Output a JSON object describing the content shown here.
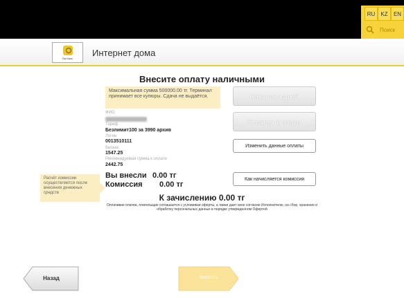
{
  "languages": [
    "RU",
    "KZ",
    "EN"
  ],
  "search": {
    "placeholder": "Поиск",
    "icon": "search-icon"
  },
  "header": {
    "title": "Интернет дома",
    "logo_caption": "Ва-банк"
  },
  "main": {
    "heading": "Внесите оплату наличными",
    "notice": "Максимальная сумма 500000.00 тг. Терминал принимает все купюры. Сдача не выдаётся.",
    "fields": {
      "fio_label": "ФИО",
      "tariff_label": "Тариф",
      "tariff_value": "Безлимит100 за 3990 архив",
      "login_label": "Логин",
      "login_value": "0013510111",
      "balance_label": "баланс",
      "balance_value": "1547.25",
      "recommended_label": "Рекомендуемая сумма к оплате",
      "recommended_value": "2442.75"
    },
    "paid_label": "Вы внесли",
    "paid_value": "0.00 тг",
    "commission_label": "Комиссия",
    "commission_value": "0.00 тг",
    "credit_text": "К зачислению 0.00 тг",
    "offer_text": "Оплачивая платеж, плательщик соглашается с условиями оферты, а также дает свое согласие Исполнителю, на сбор, хранение и обработку персональных данных в порядке утвержденном Офертой",
    "side_note": "Расчёт комиссии осуществляется после внесения денежных средств"
  },
  "buttons": {
    "pay_card": "Оплатить картой",
    "pay_credit": "Оплатить в кредит",
    "change_data": "Изменить данные оплаты",
    "commission_info": "Как начисляется комиссия",
    "back": "Назад",
    "pay": "Оплатить"
  },
  "colors": {
    "accent": "#f3c93a",
    "notice_bg": "#fbeec3",
    "topbar": "#000000"
  }
}
